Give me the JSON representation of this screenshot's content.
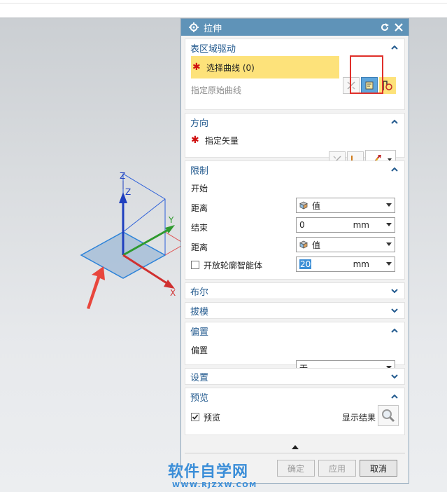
{
  "dialog": {
    "title": "拉伸"
  },
  "sections": {
    "surface_drive": {
      "title": "表区域驱动",
      "select_curve_label": "选择曲线 (0)",
      "specify_original_curve": "指定原始曲线"
    },
    "direction": {
      "title": "方向",
      "specify_vector": "指定矢量"
    },
    "limits": {
      "title": "限制",
      "start_label": "开始",
      "start_value": "值",
      "distance1_label": "距离",
      "distance1_value": "0",
      "distance1_unit": "mm",
      "end_label": "结束",
      "end_value": "值",
      "distance2_label": "距离",
      "distance2_value": "20",
      "distance2_unit": "mm",
      "open_profile_label": "开放轮廓智能体"
    },
    "boolean": {
      "title": "布尔"
    },
    "draft": {
      "title": "拔模"
    },
    "offset": {
      "title": "偏置",
      "offset_label": "偏置",
      "offset_value": "无"
    },
    "settings": {
      "title": "设置"
    },
    "preview": {
      "title": "预览",
      "preview_label": "预览",
      "preview_checked": true,
      "show_result": "显示结果"
    }
  },
  "buttons": {
    "ok": "确定",
    "apply": "应用",
    "cancel": "取消"
  },
  "axes": {
    "z_outer": "Z",
    "z_inner": "Z",
    "y": "Y",
    "x": "X"
  },
  "watermark": {
    "main": "软件自学网",
    "sub": "WWW.RJZXW.COM"
  },
  "colors": {
    "title_bar": "#5f93b8",
    "section_title": "#245b8f",
    "selection_highlight": "#fde27a",
    "annotation_red": "#e0302a",
    "watermark_blue": "#3b8ed8"
  }
}
